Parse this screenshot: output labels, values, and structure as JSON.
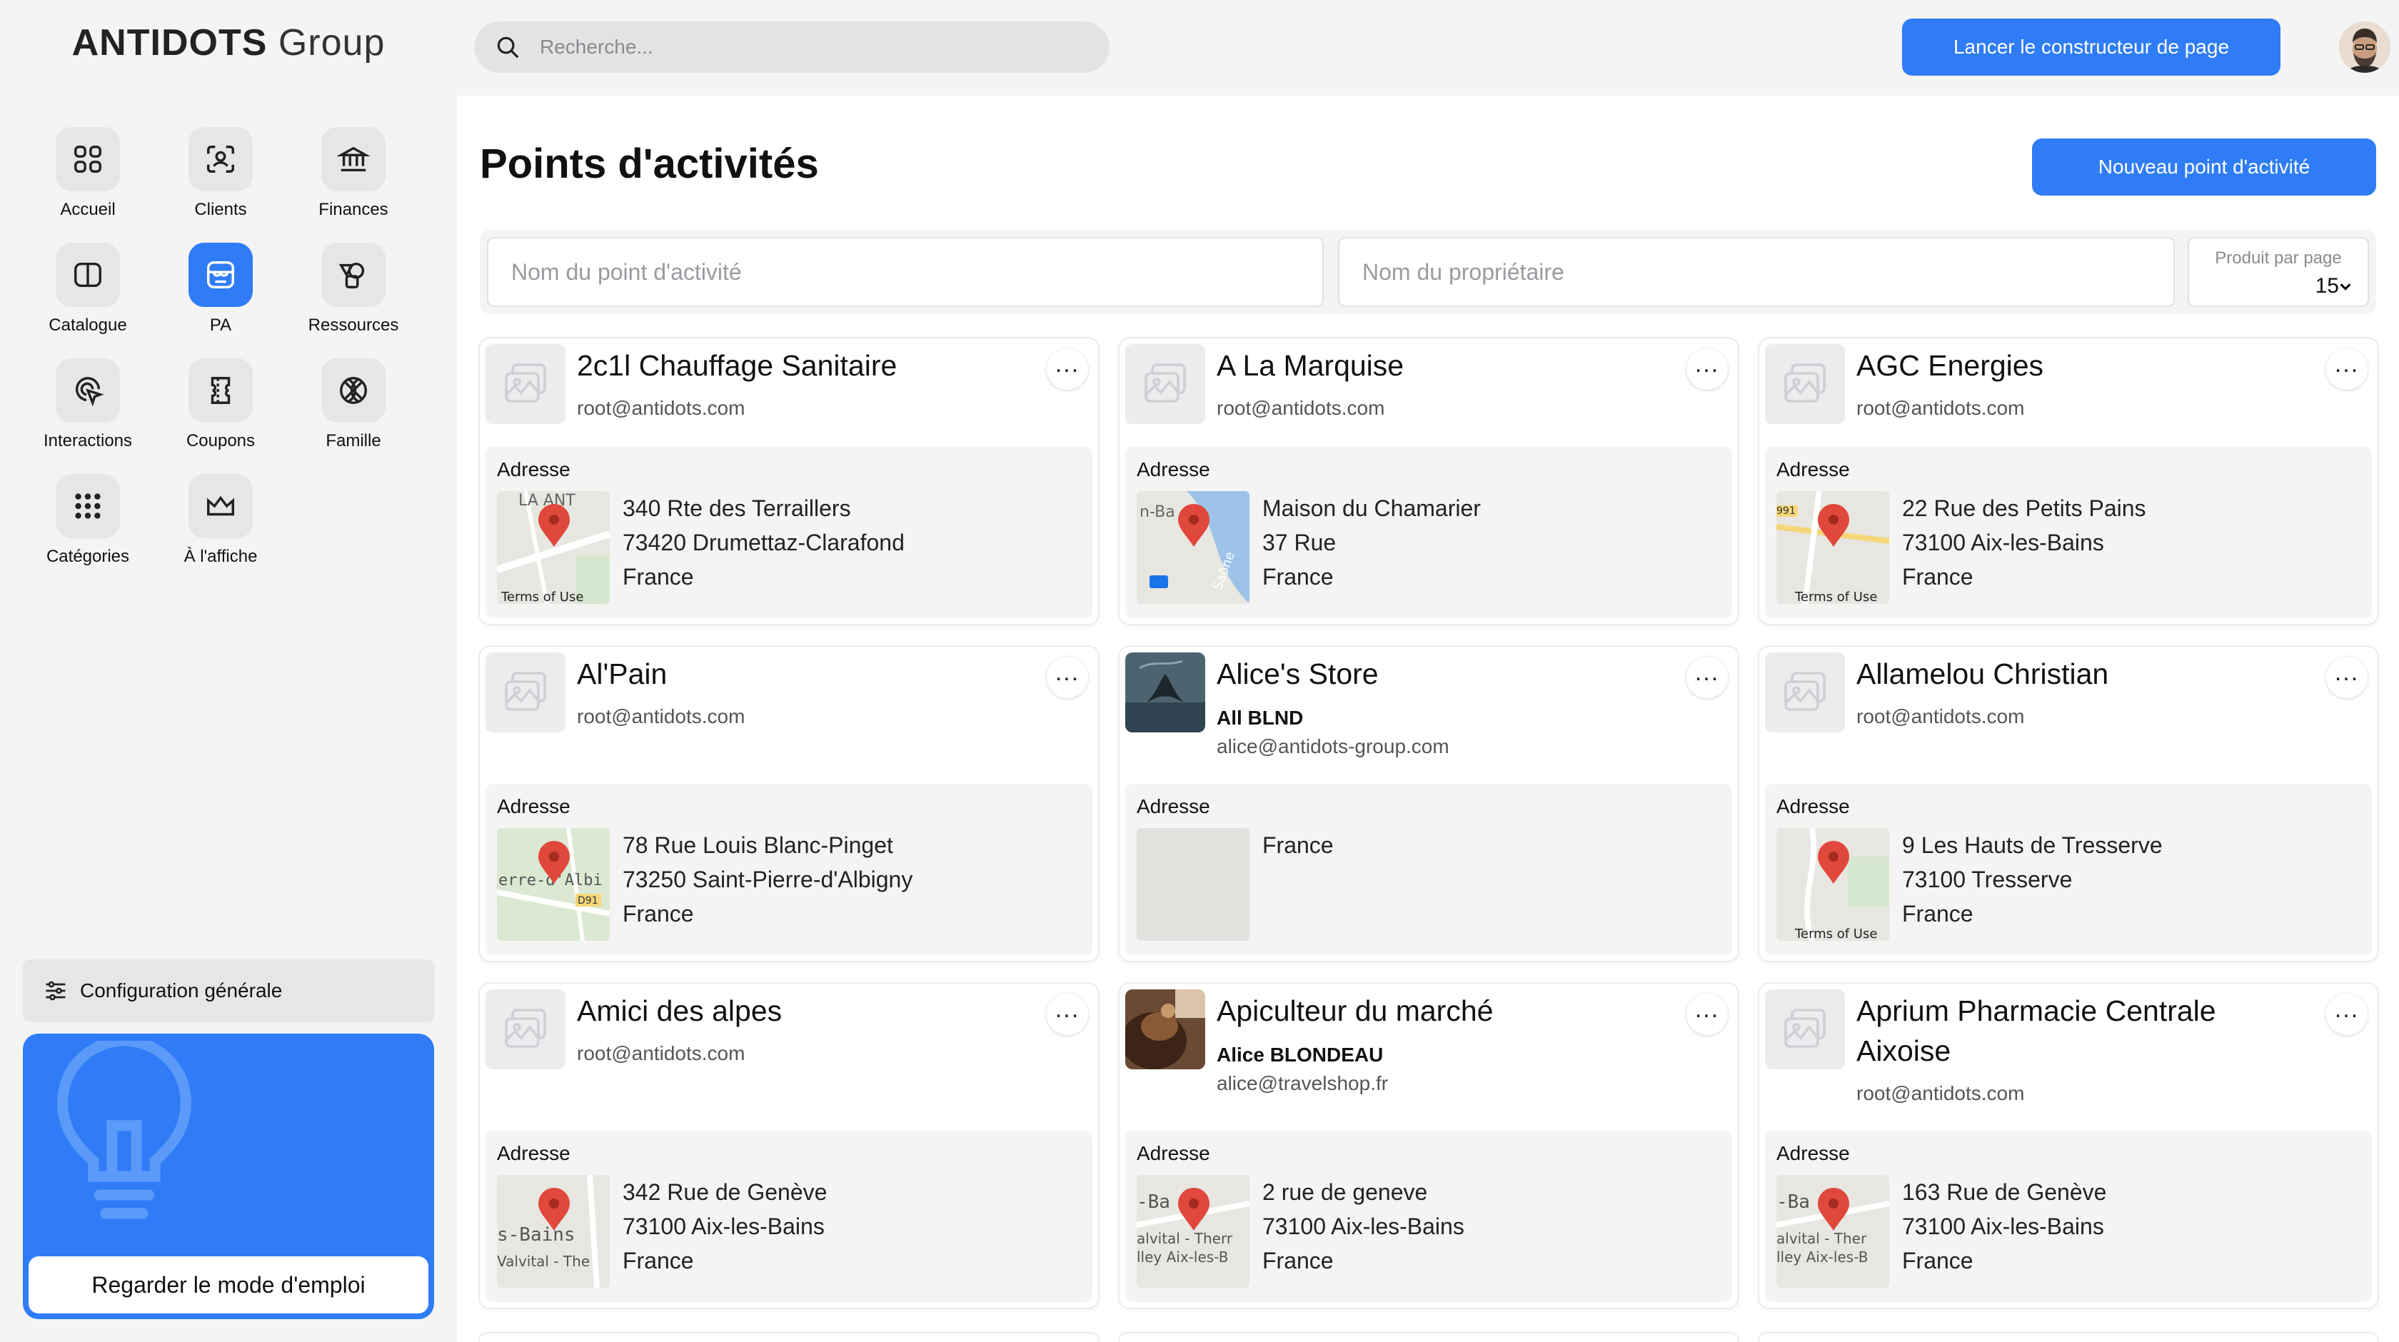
{
  "brand": {
    "name_bold": "ANTIDOTS",
    "name_light": "Group"
  },
  "nav": [
    {
      "label": "Accueil",
      "icon": "grid-icon",
      "active": false
    },
    {
      "label": "Clients",
      "icon": "face-scan-icon",
      "active": false
    },
    {
      "label": "Finances",
      "icon": "bank-icon",
      "active": false
    },
    {
      "label": "Catalogue",
      "icon": "book-icon",
      "active": false
    },
    {
      "label": "PA",
      "icon": "store-icon",
      "active": true
    },
    {
      "label": "Ressources",
      "icon": "shapes-icon",
      "active": false
    },
    {
      "label": "Interactions",
      "icon": "cursor-click-icon",
      "active": false
    },
    {
      "label": "Coupons",
      "icon": "ticket-icon",
      "active": false
    },
    {
      "label": "Famille",
      "icon": "ball-icon",
      "active": false
    },
    {
      "label": "Catégories",
      "icon": "dots-grid-icon",
      "active": false
    },
    {
      "label": "À l'affiche",
      "icon": "crown-icon",
      "active": false
    }
  ],
  "sidebar": {
    "config_label": "Configuration générale",
    "help_button": "Regarder le mode d'emploi"
  },
  "header": {
    "search_placeholder": "Recherche...",
    "builder_button": "Lancer le constructeur de page"
  },
  "page": {
    "title": "Points d'activités",
    "new_button": "Nouveau point d'activité"
  },
  "filters": {
    "name_placeholder": "Nom du point d'activité",
    "owner_placeholder": "Nom du propriétaire",
    "per_page_label": "Produit par page",
    "per_page_value": "15"
  },
  "address_label": "Adresse",
  "cards": [
    {
      "name": "2c1l Chauffage Sanitaire",
      "owner": "",
      "email": "root@antidots.com",
      "address": [
        "340 Rte des Terraillers",
        "73420 Drumettaz-Clarafond",
        "France"
      ],
      "map_labels": [
        "LA ANT",
        "Terms of Use"
      ],
      "thumb": "placeholder"
    },
    {
      "name": "A La Marquise",
      "owner": "",
      "email": "root@antidots.com",
      "address": [
        "Maison du Chamarier",
        "37 Rue",
        "France"
      ],
      "map_labels": [
        "n-Ba",
        "Saône"
      ],
      "thumb": "placeholder"
    },
    {
      "name": "AGC Energies",
      "owner": "",
      "email": "root@antidots.com",
      "address": [
        "22 Rue des Petits Pains",
        "73100 Aix-les-Bains",
        "France"
      ],
      "map_labels": [
        "991",
        "Terms of Use"
      ],
      "thumb": "placeholder"
    },
    {
      "name": "Al'Pain",
      "owner": "",
      "email": "root@antidots.com",
      "address": [
        "78 Rue Louis Blanc-Pinget",
        "73250 Saint-Pierre-d'Albigny",
        "France"
      ],
      "map_labels": [
        "erre-d'Albi",
        "D91"
      ],
      "thumb": "placeholder"
    },
    {
      "name": "Alice's Store",
      "owner": "All BLND",
      "email": "alice@antidots-group.com",
      "address": [
        "France"
      ],
      "map_labels": [],
      "thumb": "whale"
    },
    {
      "name": "Allamelou Christian",
      "owner": "",
      "email": "root@antidots.com",
      "address": [
        "9 Les Hauts de Tresserve",
        "73100 Tresserve",
        "France"
      ],
      "map_labels": [
        "Terms of Use"
      ],
      "thumb": "placeholder"
    },
    {
      "name": "Amici des alpes",
      "owner": "",
      "email": "root@antidots.com",
      "address": [
        "342 Rue de Genève",
        "73100 Aix-les-Bains",
        "France"
      ],
      "map_labels": [
        "s-Bains",
        "Valvital - The"
      ],
      "thumb": "placeholder"
    },
    {
      "name": "Apiculteur du marché",
      "owner": "Alice BLONDEAU",
      "email": "alice@travelshop.fr",
      "address": [
        "2 rue de geneve",
        "73100 Aix-les-Bains",
        "France"
      ],
      "map_labels": [
        "-Ba",
        "alvital - Therr",
        "lley Aix-les-B"
      ],
      "thumb": "honey"
    },
    {
      "name": "Aprium Pharmacie Centrale Aixoise",
      "owner": "",
      "email": "root@antidots.com",
      "address": [
        "163 Rue de Genève",
        "73100 Aix-les-Bains",
        "France"
      ],
      "map_labels": [
        "-Ba",
        "alvital - Ther",
        "lley Aix-les-B"
      ],
      "thumb": "placeholder"
    }
  ]
}
